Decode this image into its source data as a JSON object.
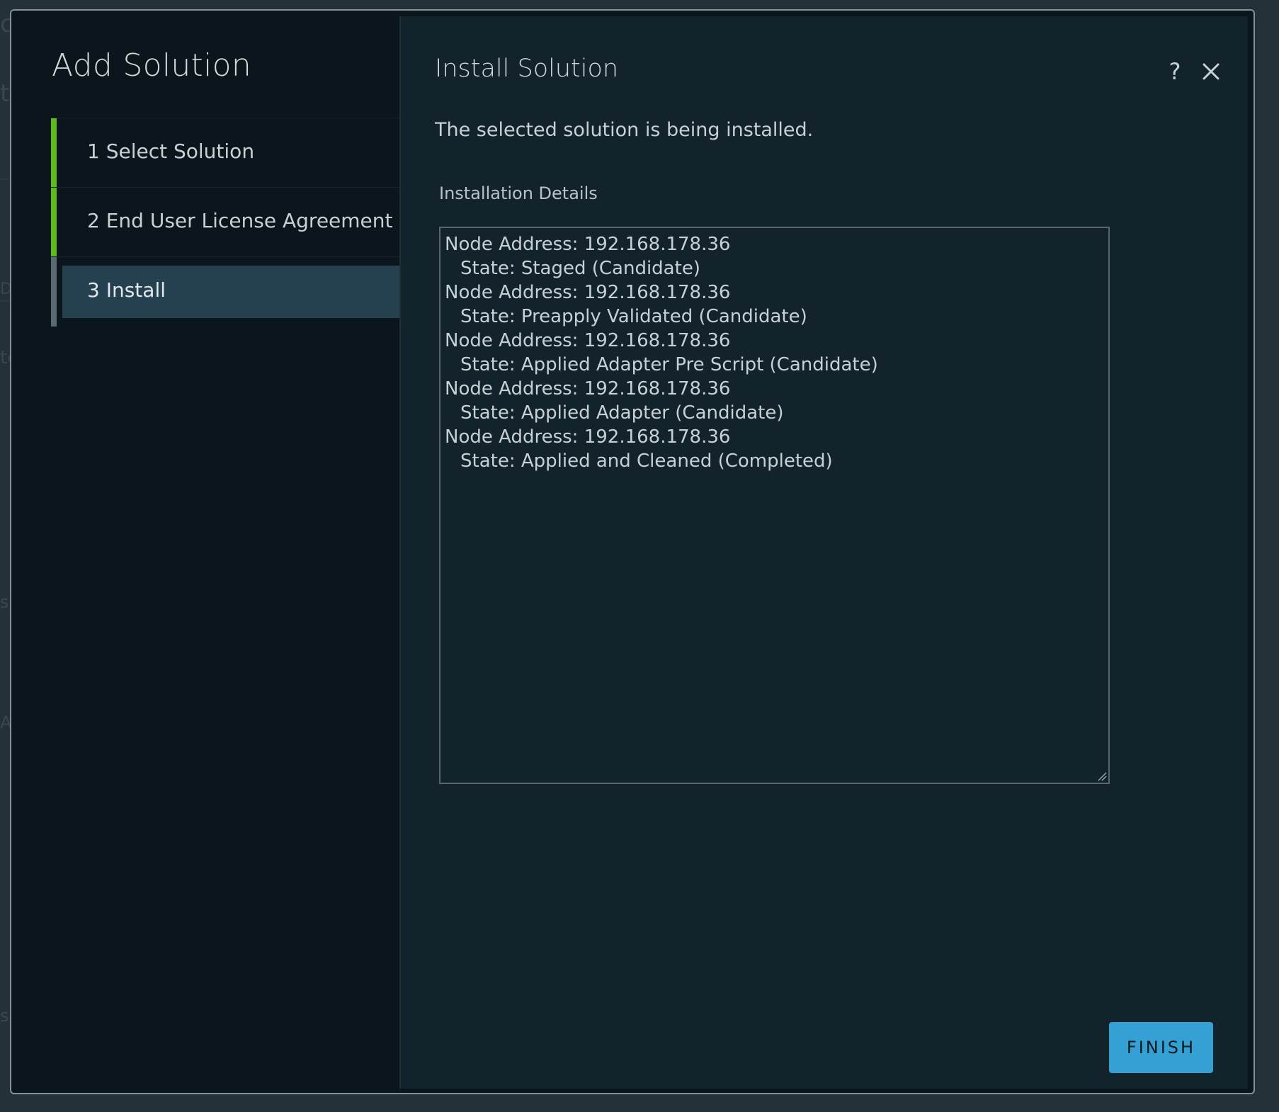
{
  "dialog": {
    "title": "Add Solution"
  },
  "wizard": {
    "steps": [
      {
        "number": "1",
        "label": "1  Select Solution",
        "state": "completed"
      },
      {
        "number": "2",
        "label": "2 End User License Agreement",
        "state": "completed"
      },
      {
        "number": "3",
        "label": "3 Install",
        "state": "current"
      }
    ]
  },
  "content": {
    "title": "Install Solution",
    "description": "The selected solution is being installed.",
    "help_icon": "?",
    "details_label": "Installation Details",
    "details_lines": [
      "Node Address: 192.168.178.36",
      "State: Staged (Candidate)",
      "Node Address: 192.168.178.36",
      "State: Preapply Validated (Candidate)",
      "Node Address: 192.168.178.36",
      "State: Applied Adapter Pre Script (Candidate)",
      "Node Address: 192.168.178.36",
      "State: Applied Adapter (Candidate)",
      "Node Address: 192.168.178.36",
      "State: Applied and Cleaned (Completed)"
    ],
    "finish_label": "FINISH"
  },
  "icons": {
    "help": "help-icon",
    "close": "close-icon",
    "resize": "resize-handle-icon"
  },
  "colors": {
    "accent_green": "#5fb81e",
    "accent_blue": "#34a0d4",
    "active_step_bg": "#25404f"
  }
}
